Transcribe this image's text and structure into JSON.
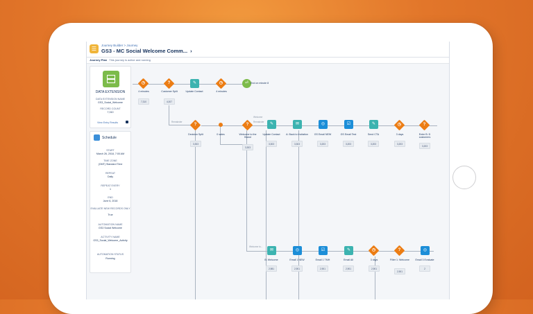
{
  "header": {
    "breadcrumb": "Journey Builder > Journey",
    "title": "GS3 - MC Social Welcome Comm...",
    "subbar_label": "Journey Plan",
    "subbar_text": "This journey is active and running"
  },
  "entry_panel": {
    "title": "DATA EXTENSION",
    "fields": [
      {
        "label": "DATA EXTENSION NAME",
        "value": "GS3_Social_Welcome"
      },
      {
        "label": "RECORD COUNT",
        "value": "7,310"
      }
    ],
    "link": "View Entry Results"
  },
  "schedule_panel": {
    "title": "Schedule",
    "fields": [
      {
        "label": "START",
        "value": "March 26, 2018, 7:00 AM"
      },
      {
        "label": "TIME ZONE",
        "value": "(GMT) Standard Time"
      },
      {
        "label": "REPEAT",
        "value": "Daily"
      },
      {
        "label": "REPEAT EVERY",
        "value": "1"
      },
      {
        "label": "END",
        "value": "June 6, 2018"
      },
      {
        "label": "EVALUATE NEW RECORDS ONLY",
        "value": "True"
      },
      {
        "label": "AUTOMATION NAME",
        "value": "GS3 Social Welcome"
      },
      {
        "label": "ACTIVITY NAME",
        "value": "GS3_Social_Welcome_Activity"
      },
      {
        "label": "AUTOMATION STATUS",
        "value": "Running"
      }
    ]
  },
  "row1": [
    {
      "label": "4 minutes",
      "stat": "7,310"
    },
    {
      "label": "Customer Split",
      "stat": "4,007"
    },
    {
      "label": "Update Contact",
      "stat": ""
    },
    {
      "label": "4 minutes",
      "stat": ""
    },
    {
      "label": "End on minute 8",
      "stat": ""
    }
  ],
  "row2": [
    {
      "label": "Decision Split",
      "stat": "3,303"
    },
    {
      "label": "0 sales",
      "stat": ""
    },
    {
      "label": "Welcome to the Brand",
      "stat": "3,303"
    },
    {
      "label": "Update Contact",
      "stat": "3,303"
    },
    {
      "label": "A: Back to Invitation",
      "stat": "3,303"
    },
    {
      "label": "GS Email NEW",
      "stat": "3,203"
    },
    {
      "label": "GS Email Test",
      "stat": "3,203"
    },
    {
      "label": "Send CTA",
      "stat": "3,203"
    },
    {
      "label": "3 days",
      "stat": "3,203"
    },
    {
      "label": "Enter B: D customers",
      "stat": "3,203"
    }
  ],
  "row3": [
    {
      "label": "B: Welcome",
      "stat": "2,981"
    },
    {
      "label": "Email 1 NEW",
      "stat": "2,901"
    },
    {
      "label": "Email 1 TMH",
      "stat": "2,901"
    },
    {
      "label": "Email All",
      "stat": "2,901"
    },
    {
      "label": "3 days",
      "stat": "2,901"
    },
    {
      "label": "Filter 1: Welcome",
      "stat": "2,901"
    },
    {
      "label": "Email 3 Evaluate",
      "stat": "2"
    }
  ],
  "edges": {
    "e1": "Remainder",
    "e2": "Welcome",
    "e3": "Remainder",
    "e4": "Welcome to..."
  }
}
